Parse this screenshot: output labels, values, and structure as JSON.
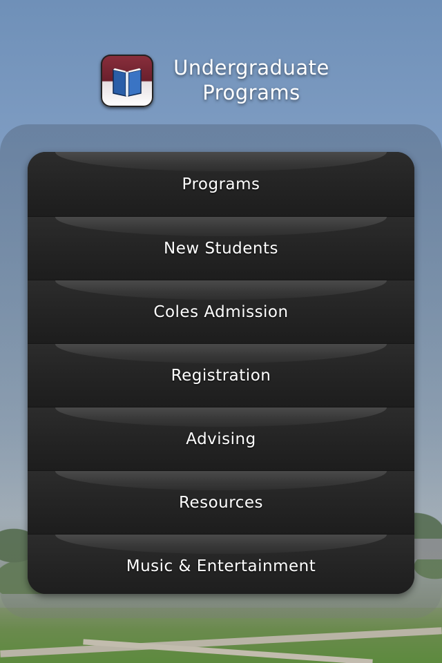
{
  "header": {
    "title_line1": "Undergraduate",
    "title_line2": "Programs",
    "icon": "book-icon"
  },
  "menu": {
    "items": [
      {
        "label": "Programs"
      },
      {
        "label": "New Students"
      },
      {
        "label": "Coles Admission"
      },
      {
        "label": "Registration"
      },
      {
        "label": "Advising"
      },
      {
        "label": "Resources"
      },
      {
        "label": "Music & Entertainment"
      }
    ]
  },
  "colors": {
    "sky": "#6f90b8",
    "menu_background": "#222222",
    "icon_accent": "#8a2f3c",
    "book_blue": "#2a5ea8"
  }
}
